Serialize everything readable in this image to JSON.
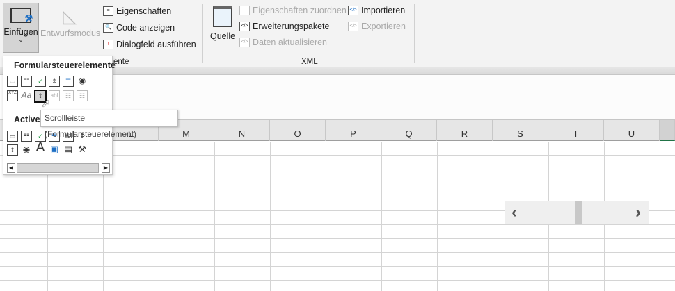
{
  "ribbon": {
    "insert_label": "Einfügen",
    "insert_chevron": "⌄",
    "design_mode": "Entwurfsmodus",
    "properties": "Eigenschaften",
    "view_code": "Code anzeigen",
    "run_dialog": "Dialogfeld ausführen",
    "controls_group": "ente",
    "source": "Quelle",
    "map_properties": "Eigenschaften zuordnen",
    "expansion_packs": "Erweiterungspakete",
    "refresh_data": "Daten aktualisieren",
    "import": "Importieren",
    "export": "Exportieren",
    "xml_group": "XML"
  },
  "dropdown": {
    "form_controls_header": "Formularsteuerelemente",
    "activex_header": "ActiveX",
    "form_row1": [
      "▭",
      "☷",
      "✓",
      "⇕",
      "☰",
      "◉"
    ],
    "form_row2": [
      "XYZ",
      "Aa",
      "⇕",
      "abl",
      "☷",
      "☷"
    ],
    "activex_row1": [
      "▭",
      "☷",
      "✓",
      "☰",
      "abl",
      "⇕"
    ],
    "activex_row2": [
      "⇕",
      "◉",
      "A",
      "▣",
      "▤",
      "⚒"
    ]
  },
  "tooltip": "Scrollleiste (Formularsteuerelement)",
  "columns": [
    "L",
    "M",
    "N",
    "O",
    "P",
    "Q",
    "R",
    "S",
    "T",
    "U"
  ],
  "scrollbar": {
    "left": "‹",
    "right": "›",
    "position": 0.48
  }
}
